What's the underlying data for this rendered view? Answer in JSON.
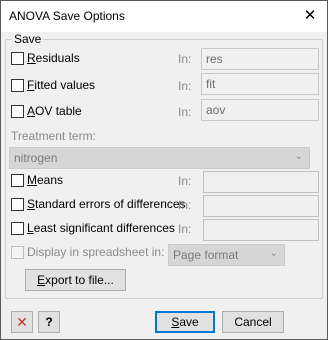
{
  "window": {
    "title": "ANOVA Save Options",
    "close_glyph": "✕"
  },
  "save_group": {
    "label": "Save",
    "in_label": "In:",
    "residuals": {
      "label_underline": "R",
      "label_rest": "esiduals",
      "value": "res"
    },
    "fitted": {
      "label_underline": "F",
      "label_rest": "itted values",
      "value": "fit"
    },
    "aov": {
      "label_underline": "A",
      "label_rest": "OV table",
      "value": "aov"
    },
    "treatment_term": {
      "label": "Treatment term:",
      "selected": "nitrogen"
    },
    "means": {
      "label_underline": "M",
      "label_rest": "eans",
      "value": ""
    },
    "sed": {
      "label_underline": "S",
      "label_rest": "tandard errors of differences",
      "value": ""
    },
    "lsd": {
      "label_underline": "L",
      "label_rest": "east significant differences",
      "value": ""
    },
    "spreadsheet": {
      "label": "Display in spreadsheet in:",
      "selected": "Page format"
    },
    "export_button": {
      "label_underline": "E",
      "label_rest": "xport to file..."
    }
  },
  "footer": {
    "cancel_icon": "✕",
    "help_icon": "?",
    "save_button": {
      "label_underline": "S",
      "label_rest": "ave"
    },
    "cancel_button": "Cancel"
  },
  "colors": {
    "accent": "#0078d7",
    "cancel_icon": "#c0392b"
  }
}
